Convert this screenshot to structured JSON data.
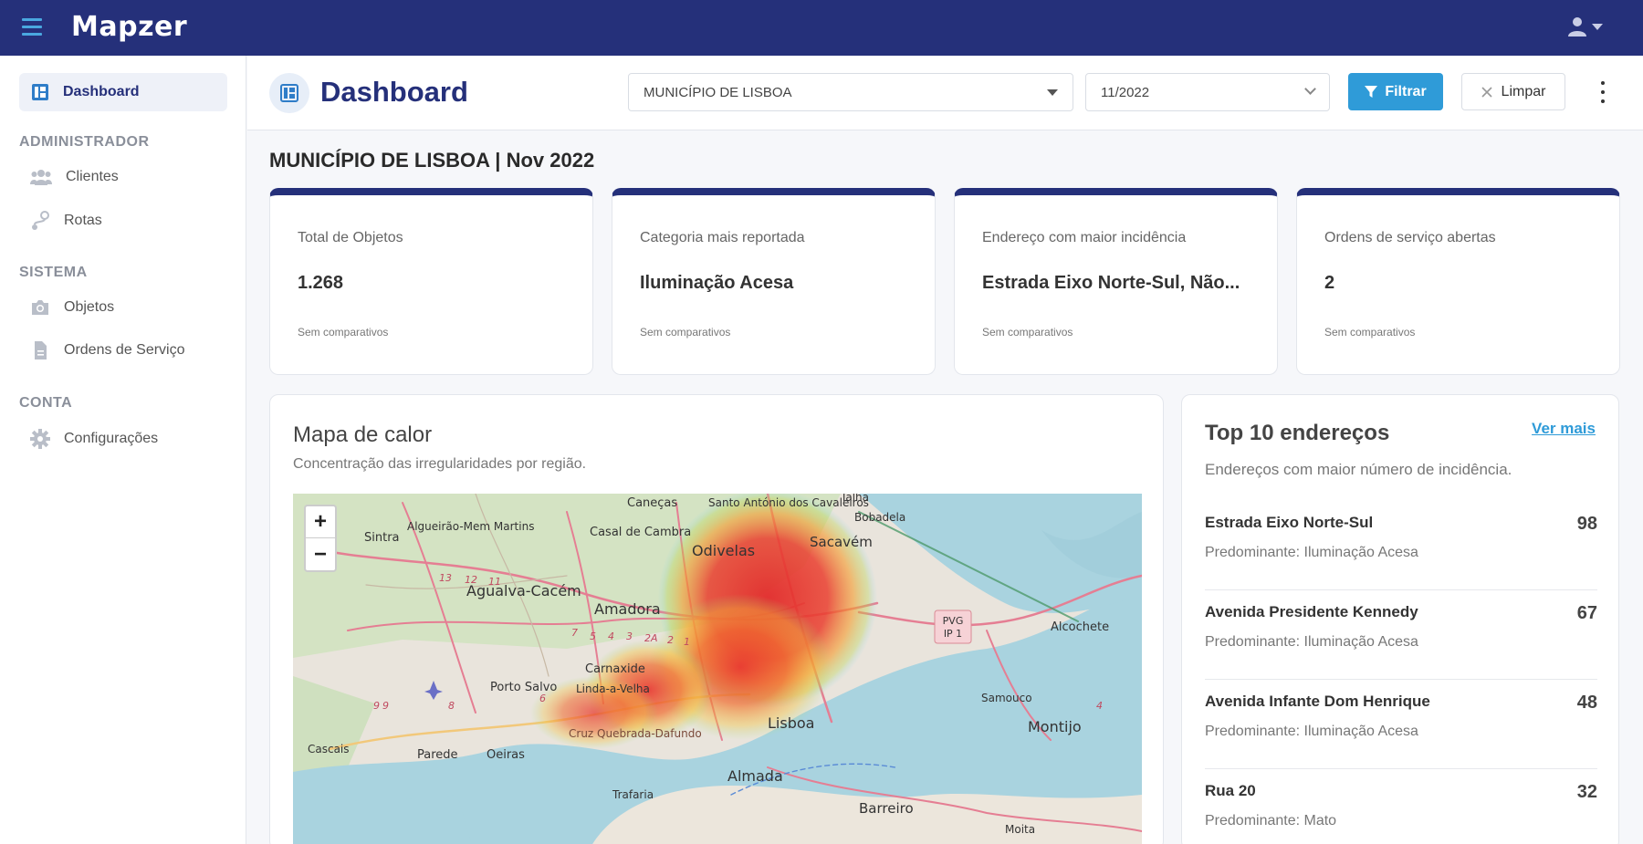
{
  "app": {
    "name": "Mapzer"
  },
  "sidebar": {
    "active": {
      "label": "Dashboard"
    },
    "sections": [
      {
        "title": "ADMINISTRADOR",
        "items": [
          {
            "label": "Clientes",
            "icon": "users-icon"
          },
          {
            "label": "Rotas",
            "icon": "route-icon"
          }
        ]
      },
      {
        "title": "SISTEMA",
        "items": [
          {
            "label": "Objetos",
            "icon": "camera-icon"
          },
          {
            "label": "Ordens de Serviço",
            "icon": "document-icon"
          }
        ]
      },
      {
        "title": "CONTA",
        "items": [
          {
            "label": "Configurações",
            "icon": "gear-icon"
          }
        ]
      }
    ]
  },
  "header": {
    "title": "Dashboard",
    "municipality_select": "MUNICÍPIO DE LISBOA",
    "date_select": "11/2022",
    "filter_label": "Filtrar",
    "clear_label": "Limpar"
  },
  "subtitle": "MUNICÍPIO DE LISBOA | Nov 2022",
  "cards": [
    {
      "label": "Total de Objetos",
      "value": "1.268",
      "compare": "Sem comparativos"
    },
    {
      "label": "Categoria mais reportada",
      "value": "Iluminação Acesa",
      "compare": "Sem comparativos"
    },
    {
      "label": "Endereço com maior incidência",
      "value": "Estrada Eixo Norte-Sul, Não...",
      "compare": "Sem comparativos"
    },
    {
      "label": "Ordens de serviço abertas",
      "value": "2",
      "compare": "Sem comparativos"
    }
  ],
  "heatmap": {
    "title": "Mapa de calor",
    "description": "Concentração das irregularidades por região.",
    "zoom_in": "+",
    "zoom_out": "−",
    "places": [
      "Caneças",
      "Santo António dos Cavaleiros",
      "Talha",
      "Bobadela",
      "Algueirão-Mem Martins",
      "Sintra",
      "Casal de Cambra",
      "Odivelas",
      "Sacavém",
      "Agualva-Cacém",
      "Amadora",
      "Alcochete",
      "Carnaxide",
      "Porto Salvo",
      "Linda-a-Velha",
      "Samouco",
      "Lisboa",
      "Montijo",
      "Cascais",
      "Parede",
      "Oeiras",
      "Cruz Quebrada-Dafundo",
      "Almada",
      "Trafaria",
      "Barreiro",
      "Moita"
    ],
    "road_badge": [
      "PVG",
      "IP 1"
    ],
    "road_numbers": [
      "13",
      "12",
      "11",
      "7",
      "5",
      "4",
      "3",
      "2A",
      "2",
      "1",
      "9",
      "9",
      "8",
      "6",
      "4"
    ]
  },
  "top10": {
    "title": "Top 10 endereços",
    "more_label": "Ver mais",
    "description": "Endereços com maior número de incidência.",
    "rows": [
      {
        "name": "Estrada Eixo Norte-Sul",
        "predominant": "Predominante: Iluminação Acesa",
        "count": "98"
      },
      {
        "name": "Avenida Presidente Kennedy",
        "predominant": "Predominante: Iluminação Acesa",
        "count": "67"
      },
      {
        "name": "Avenida Infante Dom Henrique",
        "predominant": "Predominante: Iluminação Acesa",
        "count": "48"
      },
      {
        "name": "Rua 20",
        "predominant": "Predominante: Mato",
        "count": "32"
      }
    ]
  },
  "colors": {
    "navy": "#25307a",
    "accent": "#2f9bd8",
    "heat": "#e53935"
  }
}
